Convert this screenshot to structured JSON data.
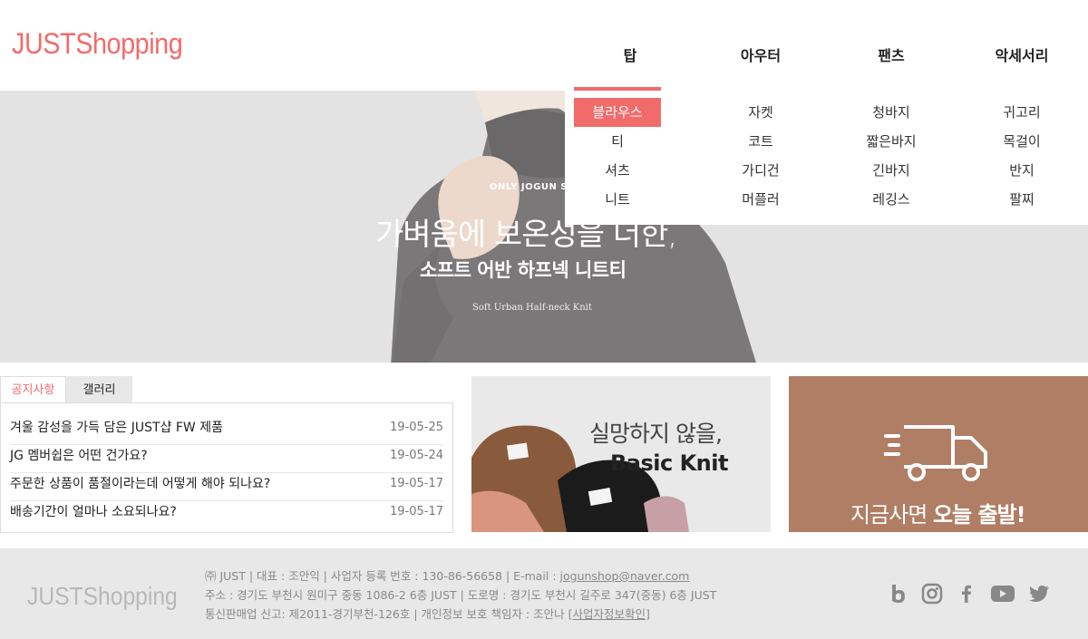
{
  "header": {
    "logo": "JUSTShopping",
    "nav": [
      "탑",
      "아우터",
      "팬츠",
      "악세서리"
    ]
  },
  "dropdown": {
    "columns": [
      [
        "블라우스",
        "티",
        "셔츠",
        "니트"
      ],
      [
        "자켓",
        "코트",
        "가디건",
        "머플러"
      ],
      [
        "청바지",
        "짧은바지",
        "긴바지",
        "레깅스"
      ],
      [
        "귀고리",
        "목걸이",
        "반지",
        "팔찌"
      ]
    ],
    "selected": "블라우스"
  },
  "hero": {
    "sub": "ONLY JOGUN ST",
    "line1": "가벼움에 보온성을 더한,",
    "line2": "소프트 어반 하프넥 니트티",
    "line3": "Soft Urban Half-neck Knit"
  },
  "notice": {
    "tabs": [
      "공지사항",
      "갤러리"
    ],
    "rows": [
      {
        "title": "겨울 감성을 가득 담은 JUST샵 FW 제품",
        "date": "19-05-25"
      },
      {
        "title": "JG 멤버쉽은 어떤 건가요?",
        "date": "19-05-24"
      },
      {
        "title": "주문한 상품이 품절이라는데 어떻게 해야 되나요?",
        "date": "19-05-17"
      },
      {
        "title": "배송기간이 얼마나 소요되나요?",
        "date": "19-05-17"
      }
    ]
  },
  "banner1": {
    "line1": "실망하지 않을,",
    "line2": "Basic Knit"
  },
  "banner2": {
    "text_light": "지금사면 ",
    "text_bold": "오늘 출발!"
  },
  "footer": {
    "logo": "JUSTShopping",
    "line1_prefix": "㈜ JUST | 대표 : 조안익 | 사업자 등록 번호 : 130-86-56658 | E-mail : ",
    "email": "jogunshop@naver.com",
    "line2": "주소 : 경기도 부천시 원미구 중동 1086-2 6층 JUST | 도로명 : 경기도 부천시 길주로 347(중동) 6층 JUST",
    "line3_prefix": "통신판매업 신고: 제2011-경기부천-126호 | 개인정보 보호 책임자 : 조안나 [",
    "biz_link": "사업자정보확인",
    "line3_suffix": "]",
    "social_icons": [
      "blog-icon",
      "instagram-icon",
      "facebook-icon",
      "youtube-icon",
      "twitter-icon"
    ]
  },
  "colors": {
    "accent": "#f26b6b",
    "footer_bg": "#e8e8e8",
    "banner2_bg": "#b07e65"
  }
}
